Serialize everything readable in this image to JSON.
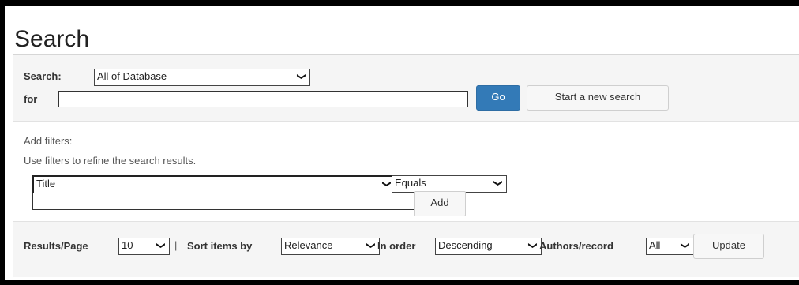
{
  "page": {
    "title": "Search"
  },
  "search": {
    "scope_label": "Search:",
    "scope_value": "All of Database",
    "for_label": "for",
    "query_value": "",
    "go_label": "Go",
    "new_search_label": "Start a new search"
  },
  "filters": {
    "heading": "Add filters:",
    "help": "Use filters to refine the search results.",
    "field_value": "Title",
    "operator_value": "Equals",
    "filter_value": "",
    "add_label": "Add"
  },
  "results": {
    "per_page_label": "Results/Page",
    "per_page_value": "10",
    "separator": "|",
    "sort_label": "Sort items by",
    "sort_value": "Relevance",
    "order_label": "In order",
    "order_value": "Descending",
    "authors_label": "Authors/record",
    "authors_value": "All",
    "update_label": "Update"
  },
  "colors": {
    "primary_button": "#337ab7",
    "panel_bg": "#f5f5f5"
  },
  "icons": {
    "dropdown": "chevron-down-icon"
  }
}
